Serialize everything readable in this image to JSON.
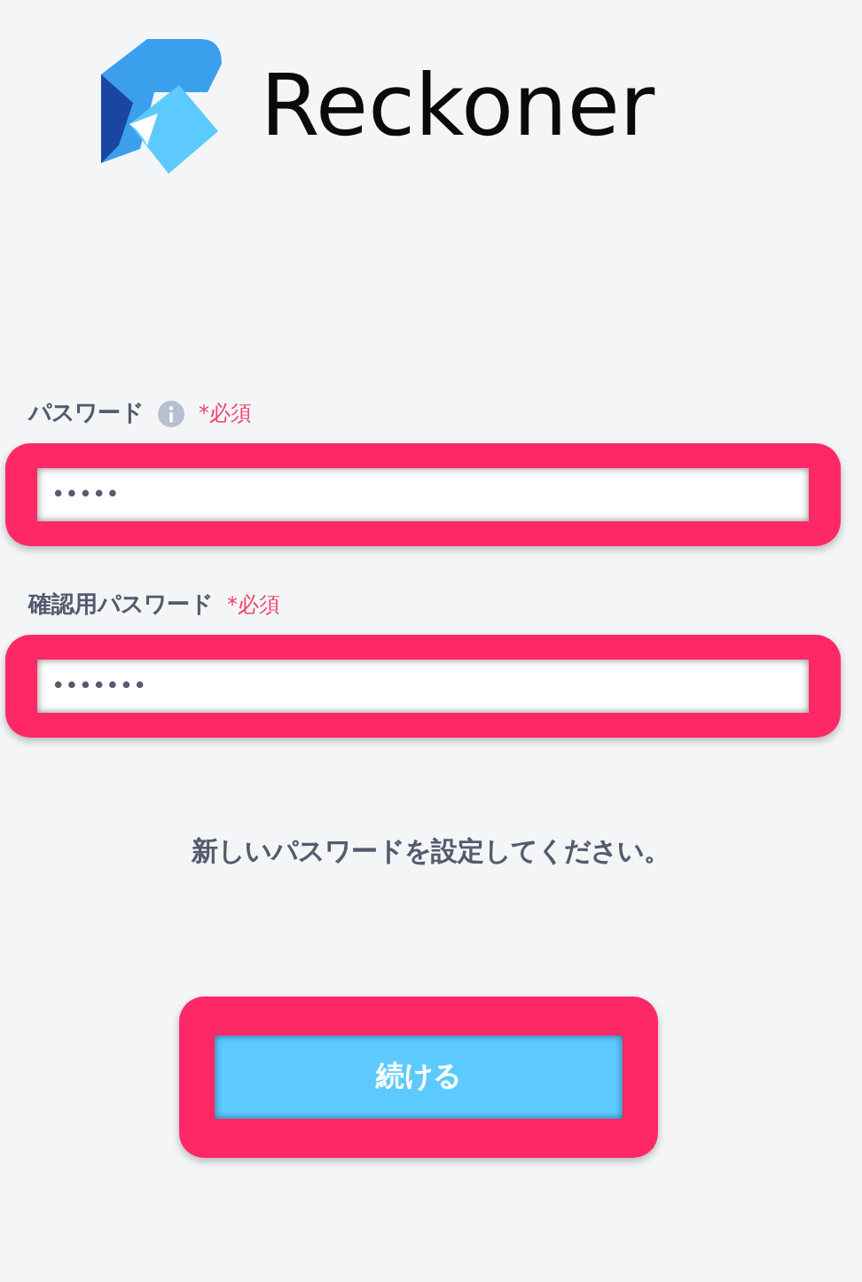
{
  "logo": {
    "text": "Reckoner"
  },
  "fields": [
    {
      "label": "パスワード",
      "info": true,
      "required": "*必須",
      "value": "•••••",
      "highlighted": true
    },
    {
      "label": "確認用パスワード",
      "info": false,
      "required": "*必須",
      "value": "•••••••",
      "highlighted": true
    }
  ],
  "message": "新しいパスワードを設定してください。",
  "button": {
    "label": "続ける",
    "highlighted": true
  }
}
